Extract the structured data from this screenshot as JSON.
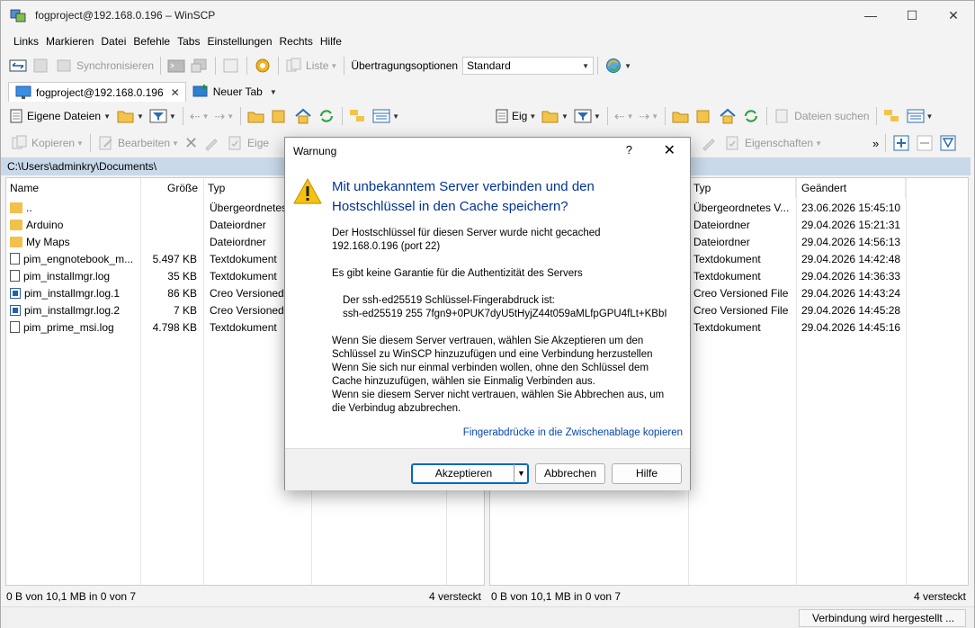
{
  "window": {
    "title": "fogproject@192.168.0.196 – WinSCP",
    "minimize": "—",
    "maximize": "☐",
    "close": "✕"
  },
  "menu": [
    "Links",
    "Markieren",
    "Datei",
    "Befehle",
    "Tabs",
    "Einstellungen",
    "Rechts",
    "Hilfe"
  ],
  "toolbar": {
    "synchronize_label": "Synchronisieren",
    "list_label": "Liste",
    "transfer_options_label": "Übertragungsoptionen",
    "transfer_options_value": "Standard"
  },
  "tabs": {
    "session_label": "fogproject@192.168.0.196",
    "new_tab_label": "Neuer Tab"
  },
  "left_panel": {
    "location_label": "Eigene Dateien",
    "copy_label": "Kopieren",
    "edit_label": "Bearbeiten",
    "properties_label": "Eige",
    "path": "C:\\Users\\adminkry\\Documents\\",
    "columns": [
      "Name",
      "Größe",
      "Typ"
    ],
    "rows": [
      {
        "name": "..",
        "size": "",
        "type": "Übergeordnetes V",
        "icon": "up"
      },
      {
        "name": "Arduino",
        "size": "",
        "type": "Dateiordner",
        "icon": "folder"
      },
      {
        "name": "My Maps",
        "size": "",
        "type": "Dateiordner",
        "icon": "folder"
      },
      {
        "name": "pim_engnotebook_m...",
        "size": "5.497 KB",
        "type": "Textdokument",
        "icon": "doc"
      },
      {
        "name": "pim_installmgr.log",
        "size": "35 KB",
        "type": "Textdokument",
        "icon": "doc"
      },
      {
        "name": "pim_installmgr.log.1",
        "size": "86 KB",
        "type": "Creo Versioned File",
        "icon": "creo"
      },
      {
        "name": "pim_installmgr.log.2",
        "size": "7 KB",
        "type": "Creo Versioned File",
        "icon": "creo"
      },
      {
        "name": "pim_prime_msi.log",
        "size": "4.798 KB",
        "type": "Textdokument",
        "icon": "doc"
      }
    ],
    "status_left": "0 B von 10,1 MB in 0 von 7",
    "status_right": "4 versteckt"
  },
  "right_panel": {
    "location_label": "Eig",
    "find_files_label": "Dateien suchen",
    "properties_label": "Eigenschaften",
    "columns": [
      "Typ",
      "Geändert"
    ],
    "rows": [
      {
        "type": "Übergeordnetes V...",
        "modified": "23.06.2026 15:45:10"
      },
      {
        "type": "Dateiordner",
        "modified": "29.04.2026 15:21:31"
      },
      {
        "type": "Dateiordner",
        "modified": "29.04.2026 14:56:13"
      },
      {
        "type": "Textdokument",
        "modified": "29.04.2026 14:42:48"
      },
      {
        "type": "Textdokument",
        "modified": "29.04.2026 14:36:33"
      },
      {
        "type": "Creo Versioned File",
        "modified": "29.04.2026 14:43:24"
      },
      {
        "type": "Creo Versioned File",
        "modified": "29.04.2026 14:45:28"
      },
      {
        "type": "Textdokument",
        "modified": "29.04.2026 14:45:16"
      }
    ],
    "status_left": "0 B von 10,1 MB in 0 von 7",
    "status_right": "4 versteckt"
  },
  "connection_status": "Verbindung wird hergestellt ...",
  "dialog": {
    "title": "Warnung",
    "help_glyph": "?",
    "close_glyph": "✕",
    "headline": "Mit unbekanntem Server verbinden und den Hostschlüssel in den Cache speichern?",
    "para1_line1": "Der Hostschlüssel für diesen Server wurde nicht gecached",
    "para1_line2": "192.168.0.196 (port 22)",
    "para2": "Es gibt keine Garantie für die Authentizität des Servers",
    "fp_label": "Der ssh-ed25519 Schlüssel-Fingerabdruck ist:",
    "fp_value": "ssh-ed25519 255 7fgn9+0PUK7dyU5tHyjZ44t059aMLfpGPU4fLt+KBbI",
    "para3_l1": "Wenn Sie diesem Server vertrauen, wählen Sie Akzeptieren um den",
    "para3_l2": "Schlüssel zu WinSCP hinzuzufügen und eine Verbindung herzustellen",
    "para3_l3": "Wenn Sie sich nur einmal verbinden wollen, ohne den Schlüssel dem",
    "para3_l4": "Cache hinzuzufügen, wählen sie Einmalig Verbinden aus.",
    "para3_l5": "Wenn sie diesem Server nicht vertrauen, wählen Sie Abbrechen aus, um",
    "para3_l6": "die Verbindug abzubrechen.",
    "copy_link": "Fingerabdrücke in die Zwischenablage kopieren",
    "accept_button": "Akzeptieren",
    "cancel_button": "Abbrechen",
    "help_button": "Hilfe"
  },
  "colors": {
    "accent": "#003399",
    "link": "#0645ad",
    "path_bar": "#c9d9e9",
    "primary_border": "#0067c0"
  }
}
